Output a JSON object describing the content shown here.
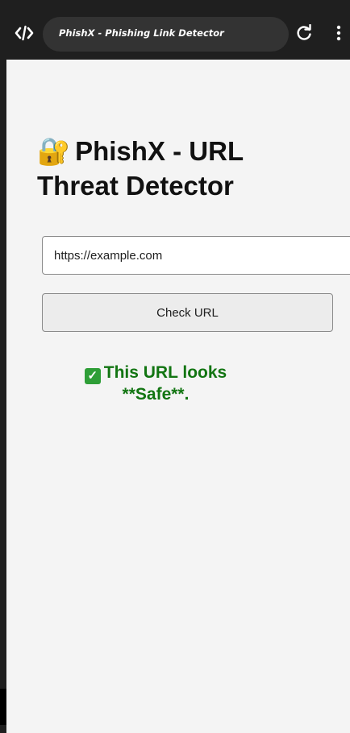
{
  "browser": {
    "tab_title": "PhishX - Phishing Link Detector",
    "icons": {
      "logo": "code-brackets-icon",
      "reload": "reload-icon",
      "menu": "kebab-menu-icon"
    }
  },
  "page": {
    "title_icon": "🔐",
    "title": "PhishX - URL Threat Detector",
    "url_input": {
      "value": "https://example.com",
      "placeholder": ""
    },
    "check_button_label": "Check URL",
    "result": {
      "icon": "✓",
      "text": "This URL looks **Safe**.",
      "status": "safe",
      "color": "#127512"
    }
  },
  "colors": {
    "toolbar_bg": "#1f1f1f",
    "page_bg": "#f4f4f4",
    "safe_green": "#127512",
    "check_badge": "#2e9e37"
  }
}
